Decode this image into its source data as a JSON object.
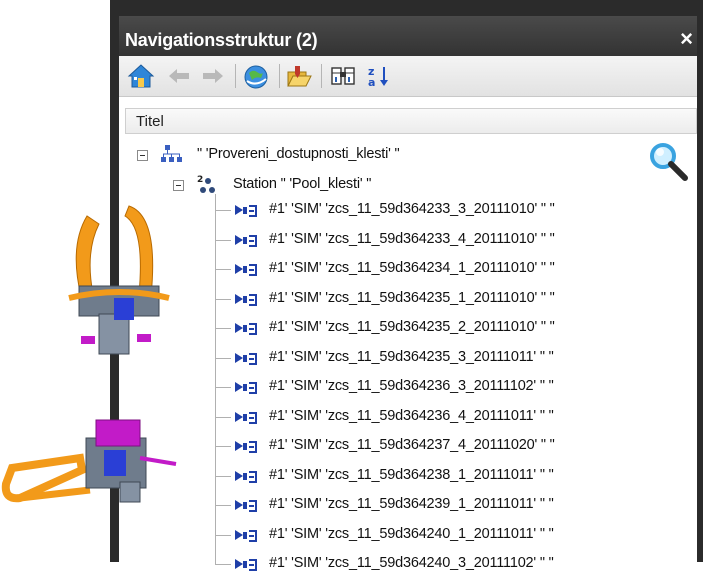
{
  "panel": {
    "title": "Navigationsstruktur (2)",
    "close_glyph": "×"
  },
  "toolbar": {
    "buttons": [
      "home-icon",
      "back-arrow-icon",
      "forward-arrow-icon",
      "globe-refresh-icon",
      "open-folder-icon",
      "binoculars-icon",
      "sort-az-icon"
    ]
  },
  "tree": {
    "column_header": "Titel",
    "root": {
      "label": "\" 'Provereni_dostupnosti_klesti' \""
    },
    "station": {
      "label": "Station \" 'Pool_klesti' \""
    },
    "items": [
      "#1' 'SIM' 'zcs_11_59d364233_3_20111010' \" \"",
      "#1' 'SIM' 'zcs_11_59d364233_4_20111010' \" \"",
      "#1' 'SIM' 'zcs_11_59d364234_1_20111010' \" \"",
      "#1' 'SIM' 'zcs_11_59d364235_1_20111010' \" \"",
      "#1' 'SIM' 'zcs_11_59d364235_2_20111010' \" \"",
      "#1' 'SIM' 'zcs_11_59d364235_3_20111011' \" \"",
      "#1' 'SIM' 'zcs_11_59d364236_3_20111102' \" \"",
      "#1' 'SIM' 'zcs_11_59d364236_4_20111011' \" \"",
      "#1' 'SIM' 'zcs_11_59d364237_4_20111020' \" \"",
      "#1' 'SIM' 'zcs_11_59d364238_1_20111011' \" \"",
      "#1' 'SIM' 'zcs_11_59d364239_1_20111011' \" \"",
      "#1' 'SIM' 'zcs_11_59d364240_1_20111011' \" \"",
      "#1' 'SIM' 'zcs_11_59d364240_3_20111102' \" \""
    ]
  },
  "colors": {
    "frame": "#2b2b2b",
    "title_bg": "#3c3c3c",
    "gun_orange": "#f29a1a",
    "gun_blue": "#2a3fd6",
    "gun_magenta": "#c21bc8",
    "gun_gray": "#6f7c8c"
  }
}
